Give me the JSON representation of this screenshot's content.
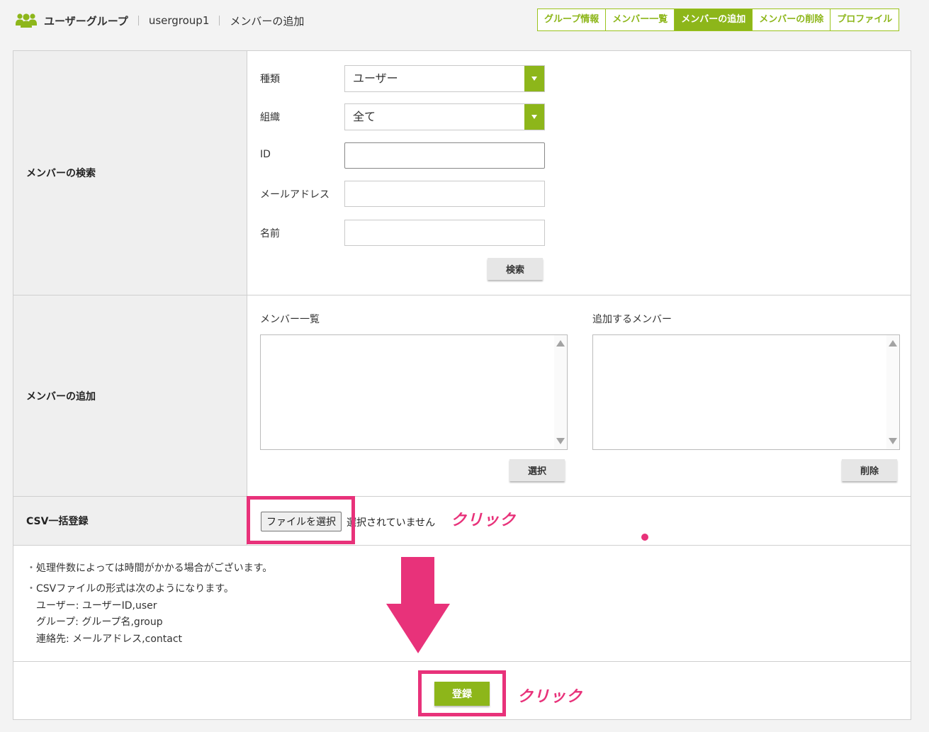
{
  "header": {
    "section": "ユーザーグループ",
    "group": "usergroup1",
    "page": "メンバーの追加"
  },
  "tabs": [
    {
      "label": "グループ情報",
      "active": false
    },
    {
      "label": "メンバー一覧",
      "active": false
    },
    {
      "label": "メンバーの追加",
      "active": true
    },
    {
      "label": "メンバーの削除",
      "active": false
    },
    {
      "label": "プロファイル",
      "active": false
    }
  ],
  "search": {
    "label": "メンバーの検索",
    "type_label": "種類",
    "type_value": "ユーザー",
    "org_label": "組織",
    "org_value": "全て",
    "id_label": "ID",
    "email_label": "メールアドレス",
    "name_label": "名前",
    "button": "検索"
  },
  "add": {
    "label": "メンバーの追加",
    "list_title": "メンバー一覧",
    "target_title": "追加するメンバー",
    "select_button": "選択",
    "delete_button": "削除"
  },
  "csv": {
    "label": "CSV一括登録",
    "file_button": "ファイルを選択",
    "file_status": "選択されていません"
  },
  "notes": {
    "line1": "処理件数によっては時間がかかる場合がございます。",
    "line2": "CSVファイルの形式は次のようになります。",
    "user": "ユーザー: ユーザーID,user",
    "group": "グループ: グループ名,group",
    "contact": "連絡先: メールアドレス,contact"
  },
  "register_button": "登録",
  "annotations": {
    "click1": "クリック",
    "click2": "クリック"
  },
  "colors": {
    "accent": "#8db61a",
    "highlight": "#e8327a"
  }
}
